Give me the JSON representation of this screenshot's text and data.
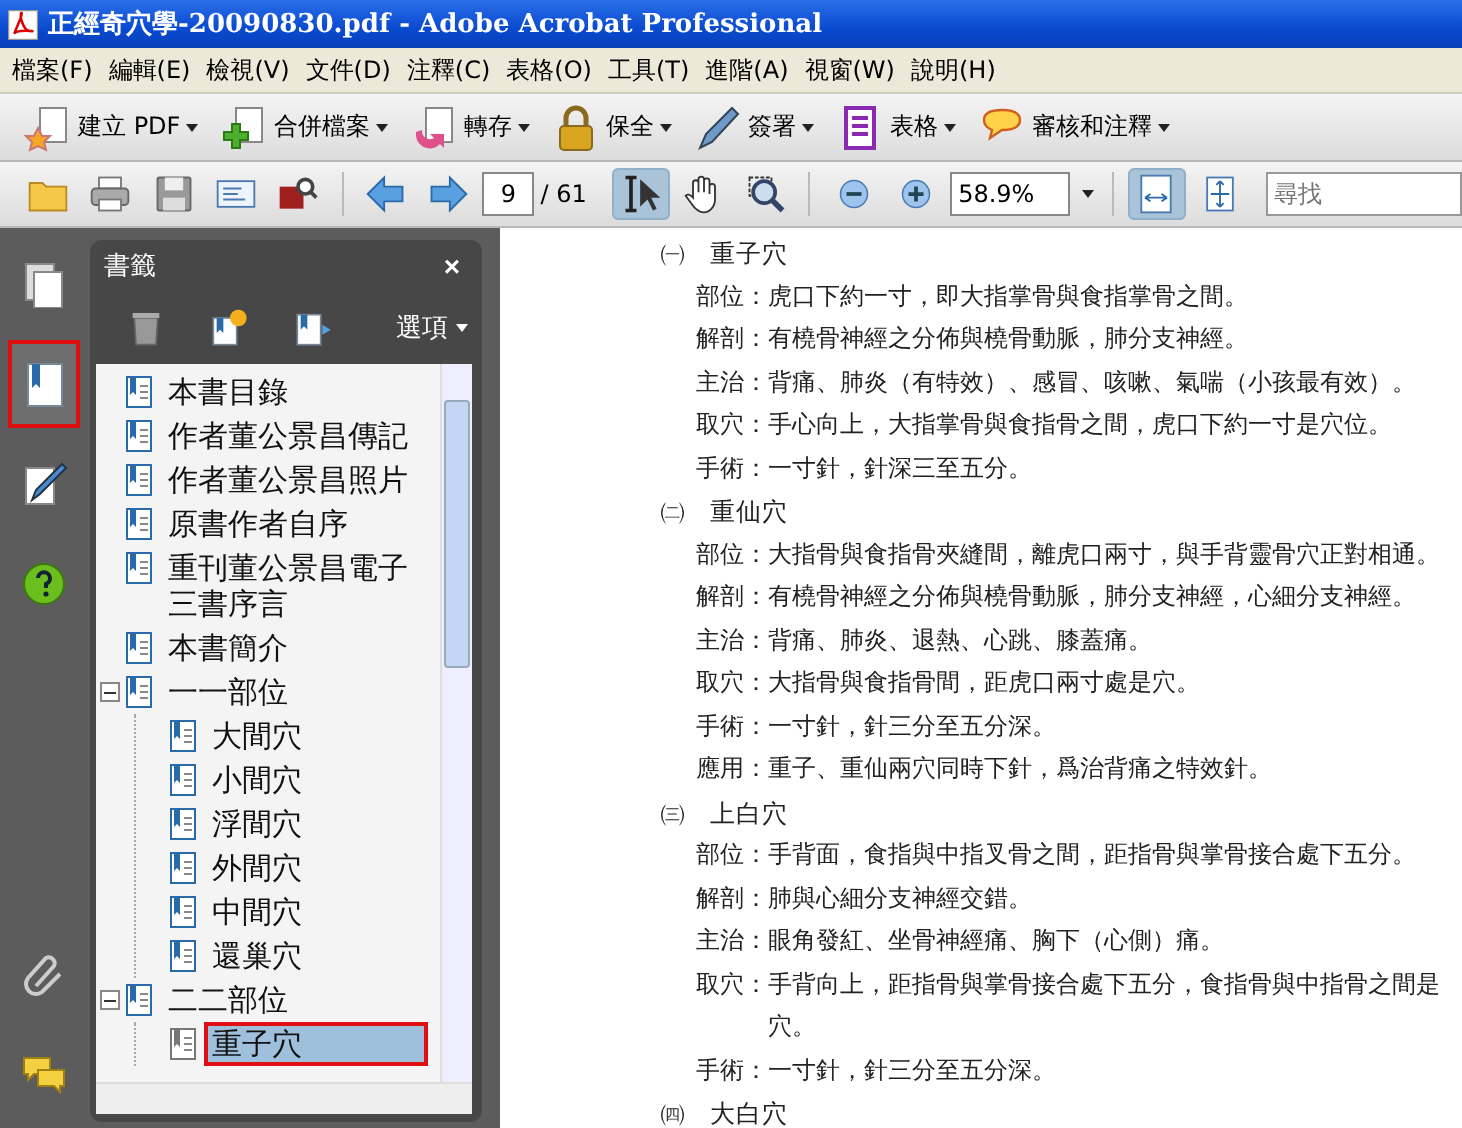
{
  "window": {
    "title": "正經奇穴學-20090830.pdf - Adobe Acrobat Professional"
  },
  "menu": [
    "檔案(F)",
    "編輯(E)",
    "檢視(V)",
    "文件(D)",
    "注釋(C)",
    "表格(O)",
    "工具(T)",
    "進階(A)",
    "視窗(W)",
    "說明(H)"
  ],
  "task_toolbar": [
    {
      "kind": "create",
      "label": "建立 PDF"
    },
    {
      "kind": "combine",
      "label": "合併檔案"
    },
    {
      "kind": "export",
      "label": "轉存"
    },
    {
      "kind": "secure",
      "label": "保全"
    },
    {
      "kind": "sign",
      "label": "簽署"
    },
    {
      "kind": "forms",
      "label": "表格"
    },
    {
      "kind": "review",
      "label": "審核和注釋"
    }
  ],
  "nav_toolbar": {
    "file_tools": [
      {
        "kind": "open"
      },
      {
        "kind": "print"
      },
      {
        "kind": "save"
      },
      {
        "kind": "email"
      },
      {
        "kind": "browse"
      }
    ],
    "page_buttons": [
      {
        "kind": "back"
      },
      {
        "kind": "forward"
      }
    ],
    "page": "9",
    "total": "/ 61",
    "tools": [
      {
        "kind": "select",
        "selected": true
      },
      {
        "kind": "hand",
        "selected": false
      },
      {
        "kind": "zoom",
        "selected": false
      }
    ],
    "zoom_buttons": [
      {
        "kind": "zoom-out"
      },
      {
        "kind": "zoom-in"
      }
    ],
    "zoom": "58.9%",
    "view_tools": [
      {
        "kind": "fit-width",
        "selected": true
      },
      {
        "kind": "fit-page",
        "selected": false
      }
    ],
    "search": {
      "placeholder": "尋找"
    }
  },
  "nav_panel": [
    {
      "kind": "pages",
      "selected": false
    },
    {
      "kind": "bookmarks",
      "selected": true
    },
    {
      "kind": "signatures",
      "selected": false
    },
    {
      "kind": "help",
      "selected": false
    }
  ],
  "nav_panel_bottom": [
    {
      "kind": "attachments"
    },
    {
      "kind": "comments"
    }
  ],
  "bookmarks": {
    "title": "書籤",
    "close": "×",
    "tools": [
      {
        "kind": "delete"
      },
      {
        "kind": "new"
      },
      {
        "kind": "move"
      }
    ],
    "options": "選項",
    "items": [
      {
        "label": "本書目錄",
        "selected": false
      },
      {
        "label": "作者董公景昌傳記",
        "selected": false
      },
      {
        "label": "作者董公景昌照片",
        "selected": false
      },
      {
        "label": "原書作者自序",
        "selected": false
      },
      {
        "label": "重刊董公景昌電子三書序言",
        "selected": false
      },
      {
        "label": "本書簡介",
        "selected": false
      },
      {
        "label": "一一部位",
        "selected": false,
        "expanded": true,
        "children": [
          {
            "label": "大間穴",
            "selected": false
          },
          {
            "label": "小間穴",
            "selected": false
          },
          {
            "label": "浮間穴",
            "selected": false
          },
          {
            "label": "外間穴",
            "selected": false
          },
          {
            "label": "中間穴",
            "selected": false
          },
          {
            "label": "還巢穴",
            "selected": false
          }
        ]
      },
      {
        "label": "二二部位",
        "selected": false,
        "expanded": true,
        "children": [
          {
            "label": "重子穴",
            "selected": true
          }
        ]
      }
    ]
  },
  "document": {
    "sections": [
      {
        "marker": "㈠",
        "title": "重子穴",
        "lines": [
          "部位：虎口下約一寸，即大指掌骨與食指掌骨之間。",
          "解剖：有橈骨神經之分佈與橈骨動脈，肺分支神經。",
          "主治：背痛、肺炎（有特效）、感冒、咳嗽、氣喘（小孩最有效）。",
          "取穴：手心向上，大指掌骨與食指骨之間，虎口下約一寸是穴位。",
          "手術：一寸針，針深三至五分。"
        ]
      },
      {
        "marker": "㈡",
        "title": "重仙穴",
        "lines": [
          "部位：大指骨與食指骨夾縫間，離虎口兩寸，與手背靈骨穴正對相通。",
          "解剖：有橈骨神經之分佈與橈骨動脈，肺分支神經，心細分支神經。",
          "主治：背痛、肺炎、退熱、心跳、膝蓋痛。",
          "取穴：大指骨與食指骨間，距虎口兩寸處是穴。",
          "手術：一寸針，針三分至五分深。",
          "應用：重子、重仙兩穴同時下針，爲治背痛之特效針。"
        ]
      },
      {
        "marker": "㈢",
        "title": "上白穴",
        "lines": [
          "部位：手背面，食指與中指叉骨之間，距指骨與掌骨接合處下五分。",
          "解剖：肺與心細分支神經交錯。",
          "主治：眼角發紅、坐骨神經痛、胸下（心側）痛。",
          "取穴：手背向上，距指骨與掌骨接合處下五分，食指骨與中指骨之間是穴。",
          "手術：一寸針，針三分至五分深。"
        ]
      },
      {
        "marker": "㈣",
        "title": "大白穴"
      }
    ]
  }
}
